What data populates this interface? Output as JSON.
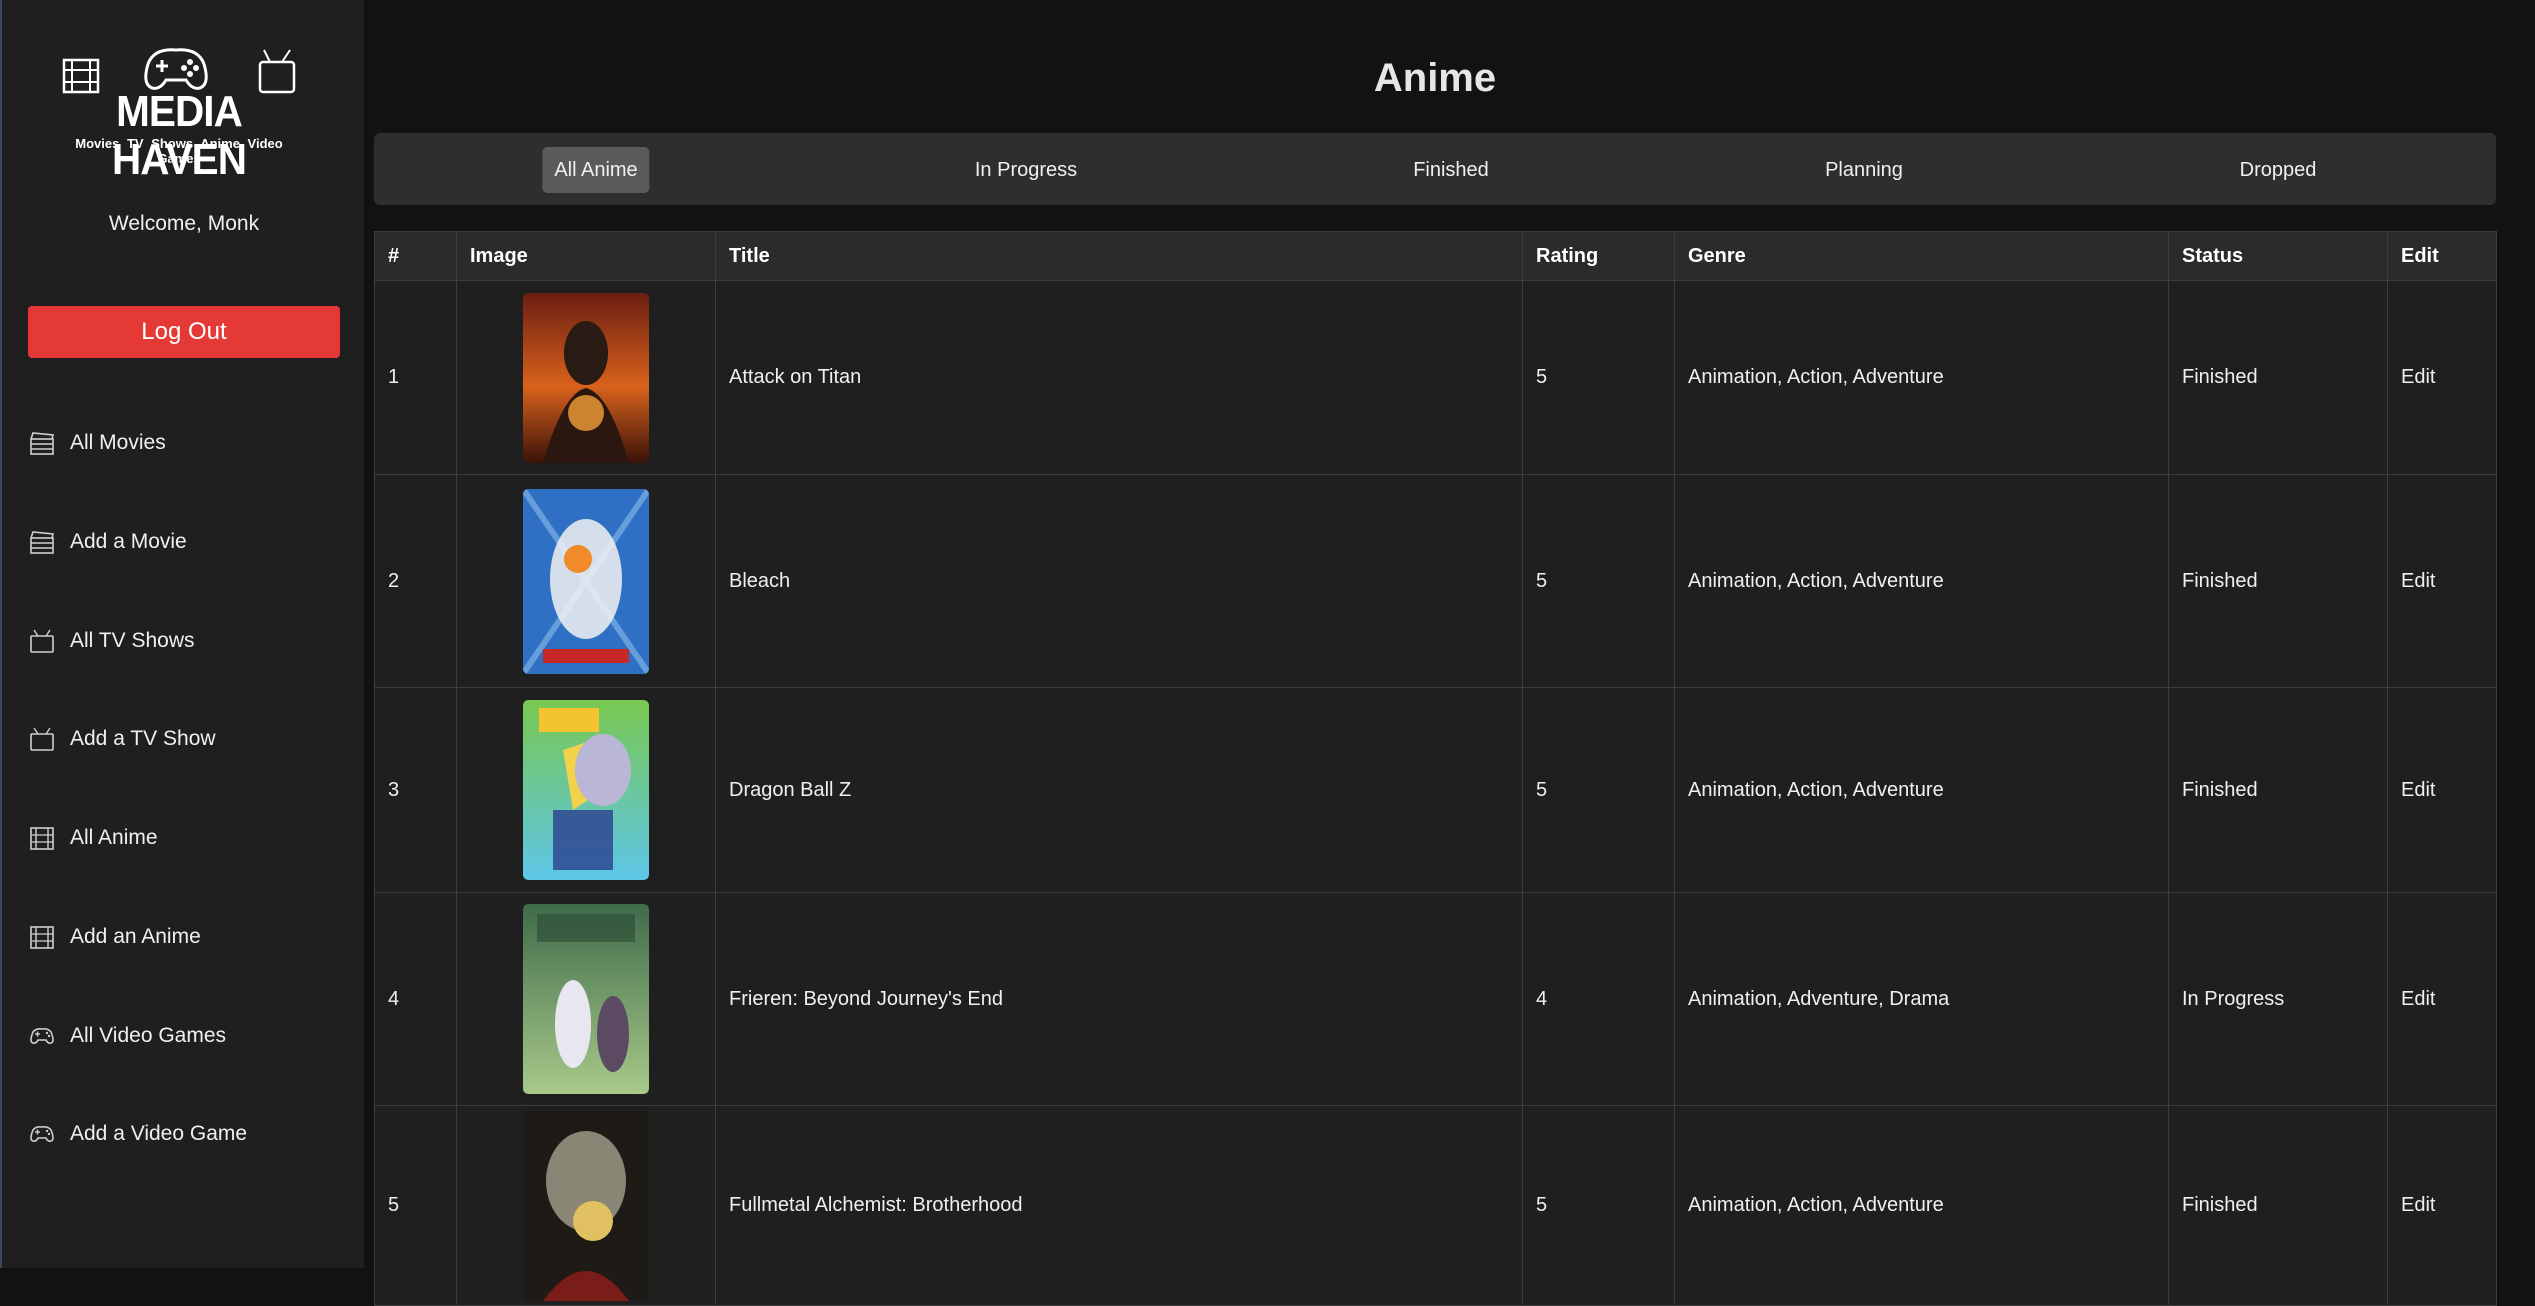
{
  "logo": {
    "brand": "MEDIA HAVEN",
    "subtitle": "Movies  TV Shows  Anime  Video Games"
  },
  "sidebar": {
    "welcome": "Welcome, Monk",
    "logout_label": "Log Out",
    "items": [
      {
        "label": "All Movies",
        "icon": "clapperboard-icon"
      },
      {
        "label": "Add a Movie",
        "icon": "clapperboard-icon"
      },
      {
        "label": "All TV Shows",
        "icon": "tv-icon"
      },
      {
        "label": "Add a TV Show",
        "icon": "tv-icon"
      },
      {
        "label": "All Anime",
        "icon": "film-icon"
      },
      {
        "label": "Add an Anime",
        "icon": "film-icon"
      },
      {
        "label": "All Video Games",
        "icon": "gamepad-icon"
      },
      {
        "label": "Add a Video Game",
        "icon": "gamepad-icon"
      }
    ]
  },
  "main": {
    "title": "Anime",
    "tabs": [
      {
        "label": "All Anime",
        "active": true
      },
      {
        "label": "In Progress",
        "active": false
      },
      {
        "label": "Finished",
        "active": false
      },
      {
        "label": "Planning",
        "active": false
      },
      {
        "label": "Dropped",
        "active": false
      }
    ],
    "table": {
      "columns": [
        "#",
        "Image",
        "Title",
        "Rating",
        "Genre",
        "Status",
        "Edit"
      ],
      "rows": [
        {
          "num": "1",
          "title": "Attack on Titan",
          "rating": "5",
          "genre": "Animation, Action, Adventure",
          "status": "Finished",
          "edit": "Edit"
        },
        {
          "num": "2",
          "title": "Bleach",
          "rating": "5",
          "genre": "Animation, Action, Adventure",
          "status": "Finished",
          "edit": "Edit"
        },
        {
          "num": "3",
          "title": "Dragon Ball Z",
          "rating": "5",
          "genre": "Animation, Action, Adventure",
          "status": "Finished",
          "edit": "Edit"
        },
        {
          "num": "4",
          "title": "Frieren: Beyond Journey's End",
          "rating": "4",
          "genre": "Animation, Adventure, Drama",
          "status": "In Progress",
          "edit": "Edit"
        },
        {
          "num": "5",
          "title": "Fullmetal Alchemist: Brotherhood",
          "rating": "5",
          "genre": "Animation, Action, Adventure",
          "status": "Finished",
          "edit": "Edit"
        }
      ]
    }
  },
  "colors": {
    "accent": "#e53935",
    "background": "#121212",
    "sidebar": "#1f1f1f",
    "active_tab": "#5a5a5a"
  }
}
